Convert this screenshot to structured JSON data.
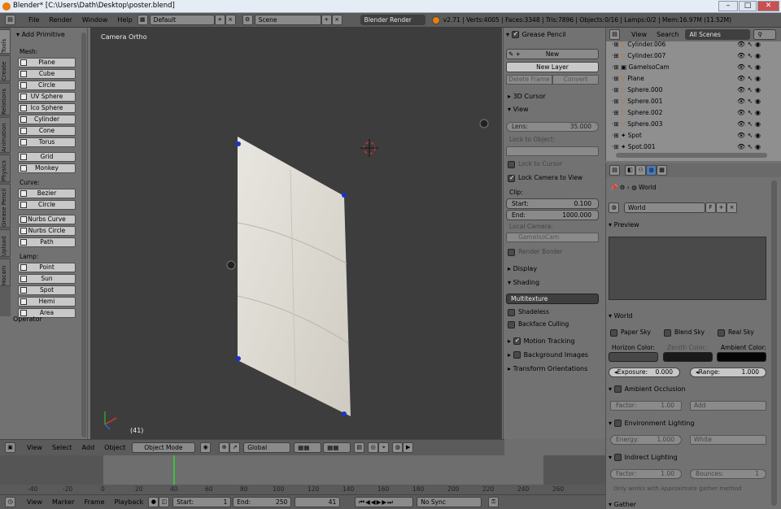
{
  "window": {
    "title": "Blender* [C:\\Users\\Dath\\Desktop\\poster.blend]"
  },
  "infobar": {
    "menus": [
      "File",
      "Render",
      "Window",
      "Help"
    ],
    "layout": "Default",
    "scene": "Scene",
    "engine": "Blender Render",
    "stats": "v2.71 | Verts:4005 | Faces:3348 | Tris:7896 | Objects:0/16 | Lamps:0/2 | Mem:16.97M (11.52M)"
  },
  "toolshelf": {
    "tabs": [
      "Tools",
      "Create",
      "Relations",
      "Animation",
      "Physics",
      "Grease Pencil",
      "Upload",
      "Hocam"
    ],
    "title": "Add Primitive",
    "mesh_label": "Mesh:",
    "mesh": [
      "Plane",
      "Cube",
      "Circle",
      "UV Sphere",
      "Ico Sphere",
      "Cylinder",
      "Cone",
      "Torus"
    ],
    "other": [
      "Grid",
      "Monkey"
    ],
    "curve_label": "Curve:",
    "curve": [
      "Bezier",
      "Circle",
      "Nurbs Curve",
      "Nurbs Circle",
      "Path"
    ],
    "lamp_label": "Lamp:",
    "lamp": [
      "Point",
      "Sun",
      "Spot",
      "Hemi",
      "Area"
    ],
    "operator": "Operator"
  },
  "viewport": {
    "view_label": "Camera Ortho",
    "frame": "(41)"
  },
  "npanel": {
    "grease_pencil": "Grease Pencil",
    "new": "New",
    "new_layer": "New Layer",
    "delete_frame": "Delete Frame",
    "convert": "Convert",
    "cursor": "3D Cursor",
    "view": "View",
    "lens_label": "Lens:",
    "lens_value": "35.000",
    "lock_object": "Lock to Object:",
    "lock_cursor": "Lock to Cursor",
    "lock_camera": "Lock Camera to View",
    "clip": "Clip:",
    "start_label": "Start:",
    "start_value": "0.100",
    "end_label": "End:",
    "end_value": "1000.000",
    "local_camera": "Local Camera:",
    "camera_name": "GameIsoCam",
    "render_border": "Render Border",
    "display": "Display",
    "shading": "Shading",
    "shading_mode": "Multitexture",
    "shadeless": "Shadeless",
    "backface": "Backface Culling",
    "motion_tracking": "Motion Tracking",
    "background_images": "Background Images",
    "transform_orient": "Transform Orientations"
  },
  "outliner": {
    "menus": [
      "View",
      "Search"
    ],
    "filter": "All Scenes",
    "rows": [
      "Cylinder.006",
      "Cylinder.007",
      "GameIsoCam",
      "Plane",
      "Sphere.000",
      "Sphere.001",
      "Sphere.002",
      "Sphere.003",
      "Spot",
      "Spot.001"
    ]
  },
  "properties": {
    "world_crumb": "World",
    "world_name": "World",
    "fake_user": "F",
    "preview": "Preview",
    "world": "World",
    "paper_sky": "Paper Sky",
    "blend_sky": "Blend Sky",
    "real_sky": "Real Sky",
    "horizon": "Horizon Color:",
    "zenith": "Zenith Color:",
    "ambient": "Ambient Color:",
    "exposure_label": "Exposure:",
    "exposure": "0.000",
    "range_label": "Range:",
    "range": "1.000",
    "ao": "Ambient Occlusion",
    "factor_label": "Factor:",
    "ao_factor": "1.00",
    "ao_mode": "Add",
    "env": "Environment Lighting",
    "energy_label": "Energy:",
    "energy": "1.000",
    "env_mode": "White",
    "indirect": "Indirect Lighting",
    "ind_factor": "1.00",
    "bounces_label": "Bounces:",
    "bounces": "1",
    "note": "Only works with Approximate gather method",
    "gather": "Gather"
  },
  "header3d": {
    "menus": [
      "View",
      "Select",
      "Add",
      "Object"
    ],
    "mode": "Object Mode",
    "orientation": "Global"
  },
  "timeline": {
    "ticks": [
      "-40",
      "-20",
      "0",
      "20",
      "40",
      "60",
      "80",
      "100",
      "120",
      "140",
      "160",
      "180",
      "200",
      "220",
      "240",
      "260"
    ],
    "menus": [
      "View",
      "Marker",
      "Frame",
      "Playback"
    ],
    "start_label": "Start:",
    "start": "1",
    "end_label": "End:",
    "end": "250",
    "current": "41",
    "sync": "No Sync"
  },
  "colors": {
    "accent": "#e87d0d",
    "playhead": "#3fbf3f",
    "selection": "#1a33cc"
  }
}
